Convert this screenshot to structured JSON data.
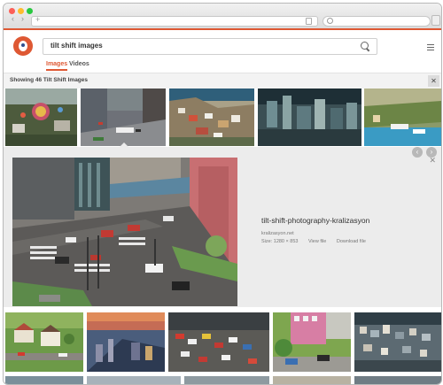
{
  "browser": {
    "new_tab_symbol": "+"
  },
  "search": {
    "query": "tilt shift images"
  },
  "tabs": [
    {
      "label": "Images",
      "active": true
    },
    {
      "label": "Videos",
      "active": false
    }
  ],
  "results": {
    "summary": "Showing 46 Tilt Shift Images",
    "close_symbol": "✕"
  },
  "detail": {
    "title": "tilt-shift-photography-kralizasyon",
    "site": "kralizasyon.net",
    "size": "Size: 1280 × 853",
    "view_file": "View file",
    "download_file": "Download file",
    "close_symbol": "✕",
    "prev_symbol": "‹",
    "next_symbol": "›"
  },
  "colors": {
    "brand": "#de5833",
    "detail_bg": "#ececec"
  }
}
